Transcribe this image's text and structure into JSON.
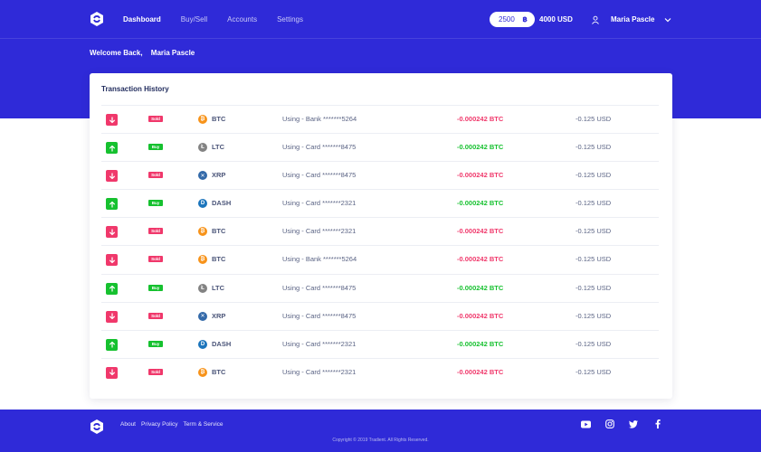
{
  "header": {
    "nav": [
      "Dashboard",
      "Buy/Sell",
      "Accounts",
      "Settings"
    ],
    "balance_amount": "2500",
    "balance_coin": "฿",
    "balance_usd": "4000 USD",
    "user_name": "Maria Pascle"
  },
  "welcome": {
    "greeting": "Welcome Back,",
    "name": "Maria Pascle"
  },
  "transactions": {
    "title": "Transaction History",
    "rows": [
      {
        "type": "Sold",
        "coin": "BTC",
        "method": "Using - Bank *******5264",
        "amount": "-0.000242 BTC",
        "usd": "-0.125 USD"
      },
      {
        "type": "Buy",
        "coin": "LTC",
        "method": "Using - Card *******8475",
        "amount": "-0.000242 BTC",
        "usd": "-0.125 USD"
      },
      {
        "type": "Sold",
        "coin": "XRP",
        "method": "Using - Card *******8475",
        "amount": "-0.000242 BTC",
        "usd": "-0.125 USD"
      },
      {
        "type": "Buy",
        "coin": "DASH",
        "method": "Using - Card *******2321",
        "amount": "-0.000242 BTC",
        "usd": "-0.125 USD"
      },
      {
        "type": "Sold",
        "coin": "BTC",
        "method": "Using - Card *******2321",
        "amount": "-0.000242 BTC",
        "usd": "-0.125 USD"
      },
      {
        "type": "Sold",
        "coin": "BTC",
        "method": "Using - Bank *******5264",
        "amount": "-0.000242 BTC",
        "usd": "-0.125 USD"
      },
      {
        "type": "Buy",
        "coin": "LTC",
        "method": "Using - Card *******8475",
        "amount": "-0.000242 BTC",
        "usd": "-0.125 USD"
      },
      {
        "type": "Sold",
        "coin": "XRP",
        "method": "Using - Card *******8475",
        "amount": "-0.000242 BTC",
        "usd": "-0.125 USD"
      },
      {
        "type": "Buy",
        "coin": "DASH",
        "method": "Using - Card *******2321",
        "amount": "-0.000242 BTC",
        "usd": "-0.125 USD"
      },
      {
        "type": "Sold",
        "coin": "BTC",
        "method": "Using - Card *******2321",
        "amount": "-0.000242 BTC",
        "usd": "-0.125 USD"
      }
    ]
  },
  "footer": {
    "links": [
      "About",
      "Privacy Policy",
      "Term & Service"
    ],
    "copyright": "Copyright © 2019 Tradient. All Rights Reserved.",
    "social": [
      "youtube-icon",
      "instagram-icon",
      "twitter-icon",
      "facebook-icon"
    ]
  },
  "colors": {
    "brand": "#2f2ad8",
    "sold": "#f0386b",
    "buy": "#16c12f",
    "btc": "#f7931a",
    "ltc": "#838383",
    "xrp": "#346aa9",
    "dash": "#1c75bc"
  }
}
